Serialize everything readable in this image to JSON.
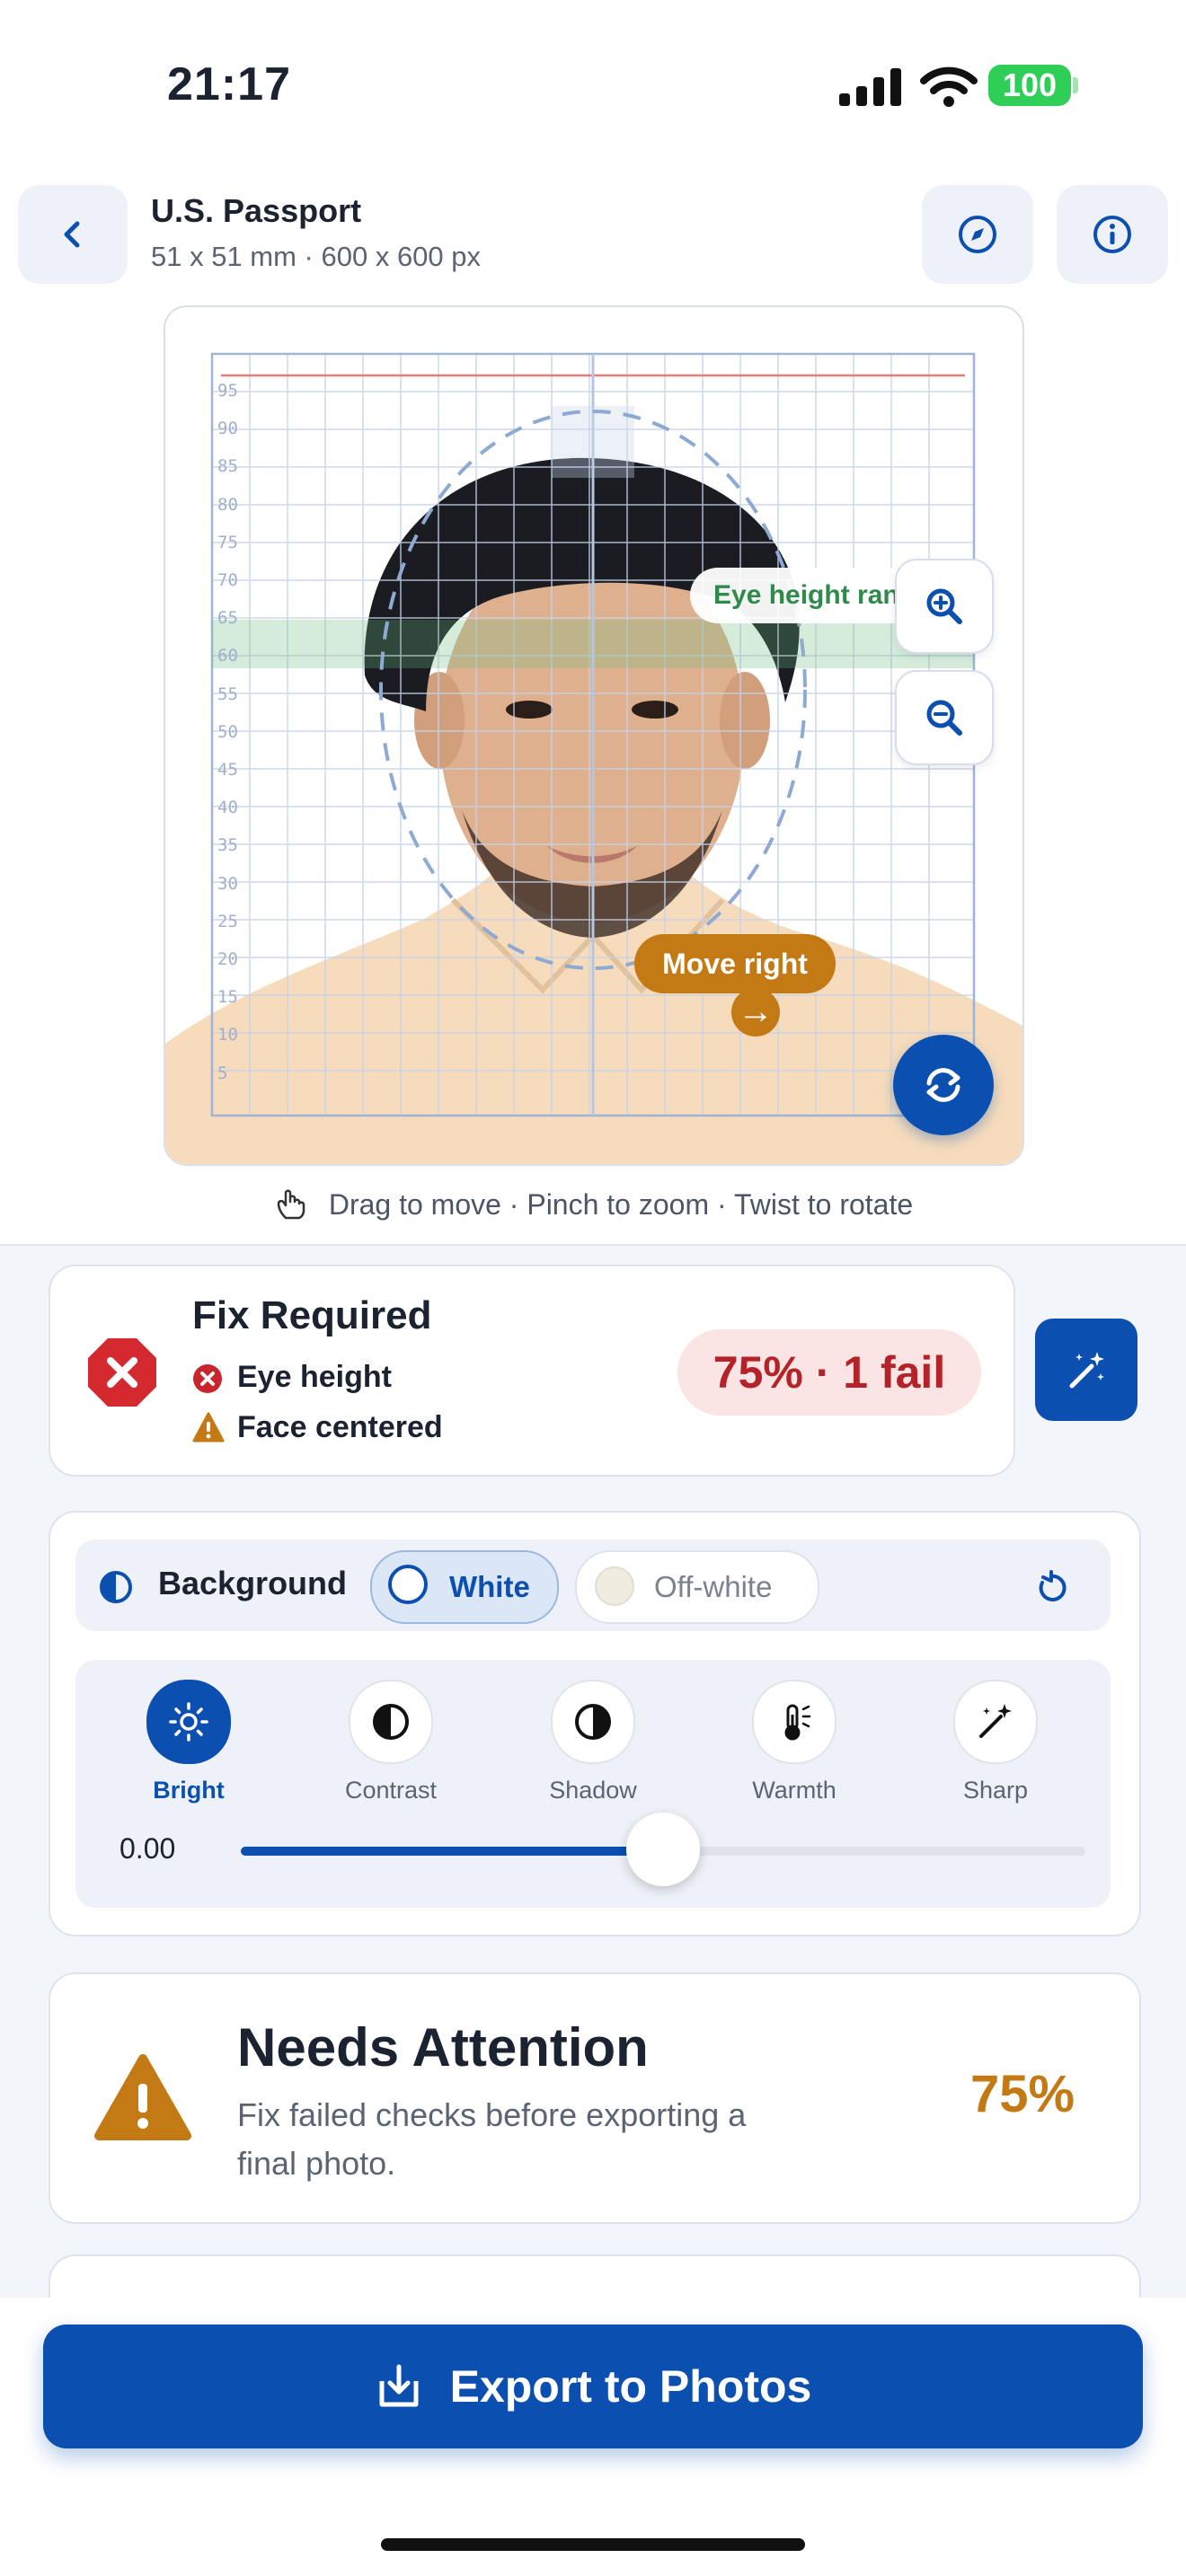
{
  "status_bar": {
    "time": "21:17",
    "battery": "100"
  },
  "header": {
    "title": "U.S. Passport",
    "subtitle": "51 x 51 mm · 600 x 600 px",
    "back_icon": "chevron-left-icon",
    "compass_icon": "compass-icon",
    "info_icon": "info-icon"
  },
  "photo": {
    "ruler_labels": [
      "95",
      "90",
      "85",
      "80",
      "75",
      "70",
      "65",
      "60",
      "55",
      "50",
      "45",
      "40",
      "35",
      "30",
      "25",
      "20",
      "15",
      "10",
      "5"
    ],
    "move_hint": "Move right",
    "move_arrow": "→",
    "eye_label": "Eye height range",
    "gesture_hint": "Drag to move · Pinch to zoom · Twist to rotate"
  },
  "status": {
    "title": "Fix Required",
    "checks": [
      {
        "label": "Eye height",
        "state": "fail"
      },
      {
        "label": "Face centered",
        "state": "warning"
      }
    ],
    "score": "75% · 1 fail"
  },
  "background": {
    "label": "Background",
    "options": [
      {
        "label": "White",
        "selected": true
      },
      {
        "label": "Off-white",
        "selected": false
      }
    ]
  },
  "adjustments": {
    "tools": [
      {
        "label": "Bright",
        "icon": "sun-icon",
        "active": true
      },
      {
        "label": "Contrast",
        "icon": "contrast-icon",
        "active": false
      },
      {
        "label": "Shadow",
        "icon": "shadow-icon",
        "active": false
      },
      {
        "label": "Warmth",
        "icon": "thermometer-icon",
        "active": false
      },
      {
        "label": "Sharp",
        "icon": "sparkle-wand-icon",
        "active": false
      }
    ],
    "value": "0.00",
    "slider_fraction": 0.5
  },
  "attention": {
    "title": "Needs Attention",
    "text": "Fix failed checks before exporting a final photo.",
    "percent": "75%"
  },
  "export": {
    "label": "Export to Photos"
  },
  "colors": {
    "accent": "#0b4fb0",
    "warning": "#c47a14",
    "error": "#b4232a",
    "success": "#2f8a4c"
  }
}
